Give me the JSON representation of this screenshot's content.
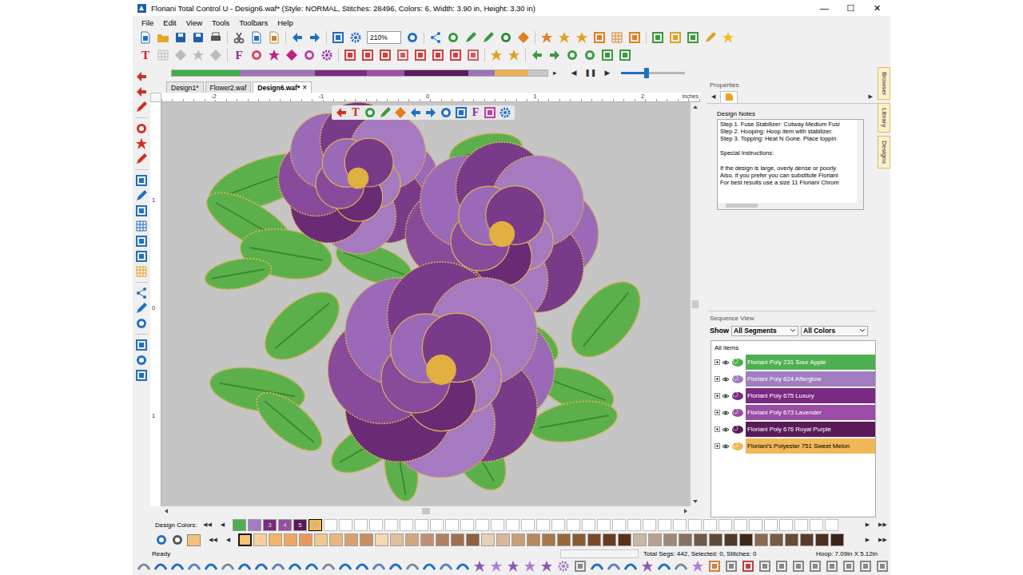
{
  "window": {
    "title": "Floriani Total Control U - Design6.waf* (Style: NORMAL, Stitches: 28496, Colors: 6, Width: 3.90 in, Height: 3.30 in)",
    "controls": [
      "—",
      "☐",
      "✕"
    ]
  },
  "menu": [
    "File",
    "Edit",
    "View",
    "Tools",
    "Toolbars",
    "Help"
  ],
  "toolbar": {
    "zoom": "210%",
    "text_icon": "T",
    "font_icon": "F"
  },
  "stitch_bar": {
    "segments": [
      {
        "color": "#3fae49",
        "level": 0.18
      },
      {
        "color": "#9b74b8",
        "level": 0.2
      },
      {
        "color": "#7b2a84",
        "level": 0.14
      },
      {
        "color": "#a050a8",
        "level": 0.1
      },
      {
        "color": "#5a1c5c",
        "level": 0.17
      },
      {
        "color": "#9b74b8",
        "level": 0.07
      },
      {
        "color": "#f0b050",
        "level": 0.09
      }
    ],
    "controls": [
      "▸",
      "◀",
      "❚❚",
      "▶"
    ],
    "slider_level": 0.4
  },
  "doc_tabs": [
    {
      "label": "Design1*",
      "selected": false
    },
    {
      "label": "Flower2.waf",
      "selected": false
    },
    {
      "label": "Design6.waf*",
      "selected": true,
      "close": "×"
    }
  ],
  "canvas_toolbar": {
    "text_icon": "T",
    "font_icon": "F"
  },
  "rulers": {
    "top": [
      "-2",
      "-1",
      "0",
      "1",
      "2"
    ],
    "left": [
      "1",
      "0",
      "1"
    ],
    "unit": "inches"
  },
  "properties": {
    "title": "Properties",
    "nav": [
      "◀",
      "▶"
    ],
    "notes_label": "Design Notes",
    "notes": [
      "Step 1. Fuse Stabilizer: Cutway Medium Fusi",
      "Step 2. Hooping: Hoop item with stabilizer.",
      "Step 3. Topping: Heat N Gone. Place toppin",
      "",
      "Special Instructions:",
      "",
      "If the design is large, overly dense or poorly",
      "Also, if you prefer you can substitute Floriani",
      "For best results use a size 11 Floriani Chrom"
    ]
  },
  "sequence": {
    "title": "Sequence View",
    "show_label": "Show",
    "segments_select": "All Segments",
    "colors_select": "All Colors",
    "root": "All items",
    "items": [
      {
        "label": "Floriani Poly 231 Sour Apple",
        "color": "#4cb050",
        "expanded": false
      },
      {
        "label": "Floriani Poly 624 Afterglow",
        "color": "#a27cc0",
        "expanded": false
      },
      {
        "label": "Floriani Poly 675 Luxury",
        "color": "#7a2a82",
        "expanded": false
      },
      {
        "label": "Floriani Poly 673 Lavender",
        "color": "#9a4ca6",
        "expanded": false
      },
      {
        "label": "Floriani Poly 676 Royal Purple",
        "color": "#5a1a58",
        "expanded": false
      },
      {
        "label": "Floriani's Polyester 751 Sweet Melon",
        "color": "#f0b858",
        "expanded": false
      }
    ]
  },
  "side_tabs": [
    "Browser",
    "Library",
    "Designs"
  ],
  "design_colors": {
    "label": "Design Colors:",
    "nav": [
      "◀◀",
      "◀",
      "▶",
      "▶▶"
    ],
    "swatches": [
      {
        "color": "#4cb050",
        "selected": false
      },
      {
        "color": "#a27cc0",
        "selected": false
      },
      {
        "number": "3",
        "color": "#7a2a82",
        "selected": false
      },
      {
        "number": "4",
        "color": "#9a4ca6",
        "selected": false
      },
      {
        "number": "5",
        "color": "#5a1a58",
        "selected": false
      },
      {
        "number": "6",
        "color": "#f0b858",
        "selected": true
      }
    ]
  },
  "palette": [
    {
      "color": "#f5c27a",
      "selected": true
    },
    {
      "color": "#f7d09a",
      "selected": false
    },
    {
      "color": "#f4b46a",
      "selected": false
    },
    {
      "color": "#f0a860",
      "selected": false
    },
    {
      "color": "#e8985a",
      "selected": false
    },
    {
      "color": "#f0c890",
      "selected": false
    },
    {
      "color": "#e8b880",
      "selected": false
    },
    {
      "color": "#d8a070",
      "selected": false
    },
    {
      "color": "#c89060",
      "selected": false
    },
    {
      "color": "#f4d8b0",
      "selected": false
    },
    {
      "color": "#e0c0a0",
      "selected": false
    },
    {
      "color": "#d0a880",
      "selected": false
    },
    {
      "color": "#c09070",
      "selected": false
    },
    {
      "color": "#b08060",
      "selected": false
    },
    {
      "color": "#a07050",
      "selected": false
    },
    {
      "color": "#906040",
      "selected": false
    },
    {
      "color": "#e8d0b8",
      "selected": false
    },
    {
      "color": "#d8b898",
      "selected": false
    },
    {
      "color": "#c8a078",
      "selected": false
    },
    {
      "color": "#b88858",
      "selected": false
    },
    {
      "color": "#a87848",
      "selected": false
    },
    {
      "color": "#986838",
      "selected": false
    },
    {
      "color": "#8a5a30",
      "selected": false
    },
    {
      "color": "#7a4a28",
      "selected": false
    },
    {
      "color": "#6a3a20",
      "selected": false
    },
    {
      "color": "#5a3018",
      "selected": false
    },
    {
      "color": "#c8b8a8",
      "selected": false
    },
    {
      "color": "#b8a090",
      "selected": false
    },
    {
      "color": "#a08878",
      "selected": false
    },
    {
      "color": "#887060",
      "selected": false
    },
    {
      "color": "#705848",
      "selected": false
    },
    {
      "color": "#604838",
      "selected": false
    },
    {
      "color": "#503828",
      "selected": false
    },
    {
      "color": "#402818",
      "selected": false
    },
    {
      "color": "#8a6a50",
      "selected": false
    },
    {
      "color": "#7a5a40",
      "selected": false
    },
    {
      "color": "#6a4a30",
      "selected": false
    },
    {
      "color": "#5a3a28",
      "selected": false
    },
    {
      "color": "#4a3020",
      "selected": false
    },
    {
      "color": "#3a2418",
      "selected": false
    }
  ],
  "status": {
    "left": "Ready",
    "segs": "Total Segs: 442, Selected: 0, Stitches: 0",
    "hoop": "Hoop: 7.09in X 5.12in"
  }
}
